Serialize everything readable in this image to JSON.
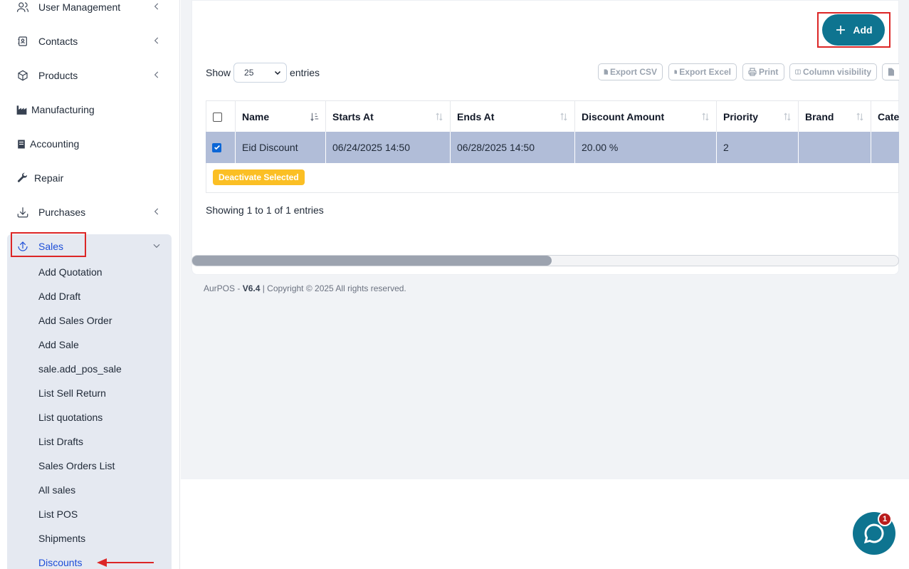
{
  "sidebar": {
    "items": [
      {
        "label": "User Management",
        "icon": "users-icon"
      },
      {
        "label": "Contacts",
        "icon": "contacts-icon"
      },
      {
        "label": "Products",
        "icon": "cube-icon"
      },
      {
        "label": "Manufacturing",
        "icon": "factory-icon"
      },
      {
        "label": "Accounting",
        "icon": "book-icon"
      },
      {
        "label": "Repair",
        "icon": "wrench-icon"
      },
      {
        "label": "Purchases",
        "icon": "download-icon"
      },
      {
        "label": "Sales",
        "icon": "upload-icon"
      }
    ],
    "sales_sub": [
      "Add Quotation",
      "Add Draft",
      "Add Sales Order",
      "Add Sale",
      "sale.add_pos_sale",
      "List Sell Return",
      "List quotations",
      "List Drafts",
      "Sales Orders List",
      "All sales",
      "List POS",
      "Shipments",
      "Discounts"
    ]
  },
  "toolbar": {
    "add_label": "Add",
    "show_label": "Show",
    "entries_value": "25",
    "entries_label": "entries",
    "export_csv": "Export CSV",
    "export_excel": "Export Excel",
    "print": "Print",
    "column_visibility": "Column visibility"
  },
  "table": {
    "columns": [
      "Name",
      "Starts At",
      "Ends At",
      "Discount Amount",
      "Priority",
      "Brand",
      "Categ"
    ],
    "rows": [
      {
        "name": "Eid Discount",
        "starts_at": "06/24/2025 14:50",
        "ends_at": "06/28/2025 14:50",
        "discount": "20.00 %",
        "priority": "2",
        "brand": "",
        "category": ""
      }
    ],
    "deactivate_label": "Deactivate Selected",
    "showing": "Showing 1 to 1 of 1 entries"
  },
  "footer": {
    "app": "AurPOS - ",
    "version": "V6.4",
    "copyright": " | Copyright © 2025 All rights reserved."
  },
  "chat": {
    "badge": "1"
  },
  "colors": {
    "primary": "#0e7490",
    "active_nav": "#1d4ed8",
    "selected_row": "#b1bdd8",
    "warning": "#fbbf24",
    "highlight": "#dc2626"
  }
}
